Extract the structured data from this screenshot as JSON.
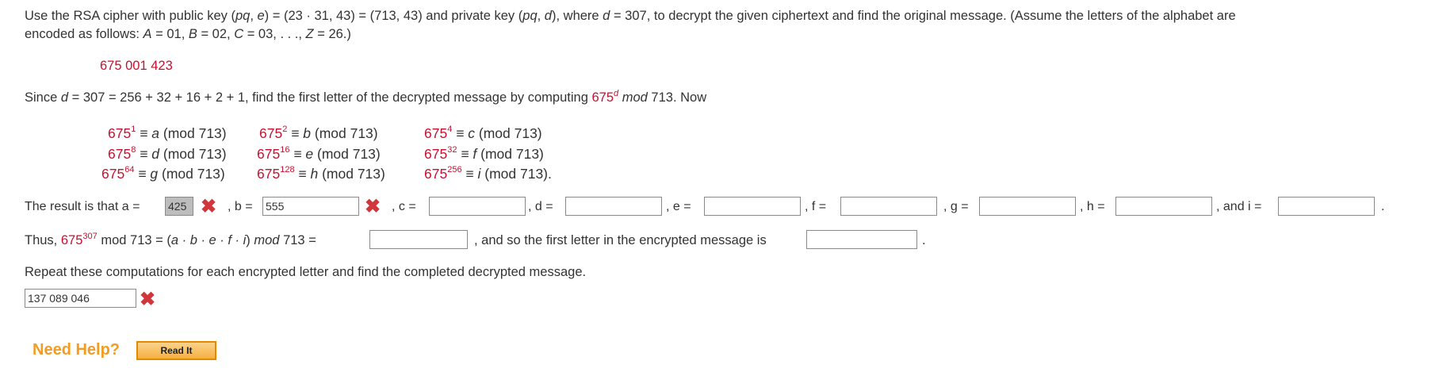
{
  "intro": {
    "text_a": "Use the RSA cipher with public key (",
    "pq": "pq",
    "text_b": ", ",
    "e": "e",
    "text_c": ") = (23 · 31, 43) = (713, 43) and private key (",
    "pq2": "pq",
    "text_d": ", ",
    "d": "d",
    "text_e": "), where ",
    "d2": "d",
    "text_f": " = 307, to decrypt the given ciphertext and find the original message. (Assume the letters of the alphabet are",
    "line2_a": "encoded as follows: ",
    "A": "A",
    "line2_b": " = 01, ",
    "B": "B",
    "line2_c": " = 02, ",
    "C": "C",
    "line2_d": " = 03, . . ., ",
    "Z": "Z",
    "line2_e": " = 26.)"
  },
  "ciphertext": "675 001 423",
  "since_line": {
    "a": "Since ",
    "d": "d",
    "b": " = 307 = 256 + 32 + 16 + 2 + 1, find the first letter of the decrypted message by computing ",
    "base": "675",
    "exp": "d",
    "mod": "mod",
    "c": " 713. Now"
  },
  "table": [
    {
      "base": "675",
      "exp": "1",
      "eq": " ≡ ",
      "var": "a",
      "mod": " (mod 713)"
    },
    {
      "base": "675",
      "exp": "2",
      "eq": " ≡ ",
      "var": "b",
      "mod": " (mod 713)"
    },
    {
      "base": "675",
      "exp": "4",
      "eq": " ≡ ",
      "var": "c",
      "mod": " (mod 713)"
    },
    {
      "base": "675",
      "exp": "8",
      "eq": " ≡ ",
      "var": "d",
      "mod": " (mod 713)"
    },
    {
      "base": "675",
      "exp": "16",
      "eq": " ≡ ",
      "var": "e",
      "mod": " (mod 713)"
    },
    {
      "base": "675",
      "exp": "32",
      "eq": " ≡ ",
      "var": "f",
      "mod": " (mod 713)"
    },
    {
      "base": "675",
      "exp": "64",
      "eq": " ≡ ",
      "var": "g",
      "mod": " (mod 713)"
    },
    {
      "base": "675",
      "exp": "128",
      "eq": " ≡ ",
      "var": "h",
      "mod": " (mod 713)"
    },
    {
      "base": "675",
      "exp": "256",
      "eq": " ≡ ",
      "var": "i",
      "mod": " (mod 713)."
    }
  ],
  "result": {
    "prefix": "The result is that a =",
    "a_value": "425",
    "b_label": ", b =",
    "b_value": "555",
    "c_label": ", c =",
    "d_label": ", d =",
    "e_label": ", e =",
    "f_label": ", f =",
    "g_label": ", g =",
    "h_label": ", h =",
    "i_label": ", and i =",
    "end": "."
  },
  "thus_line": {
    "a": "Thus, ",
    "base": "675",
    "exp": "307",
    "b": " mod 713 = (",
    "prod": "a · b · e · f · i",
    "c": ") ",
    "mod": "mod",
    "d": " 713 =",
    "e": ", and so the first letter in the encrypted message is",
    "end": "."
  },
  "repeat_text": "Repeat these computations for each encrypted letter and find the completed decrypted message.",
  "final_answer": "137 089 046",
  "help": {
    "label": "Need Help?",
    "read_it": "Read It"
  },
  "colors": {
    "accent_red": "#c8102e",
    "error_x": "#d0363b",
    "help_orange": "#f29d21"
  },
  "icons": {
    "wrong": "x-mark-icon"
  }
}
